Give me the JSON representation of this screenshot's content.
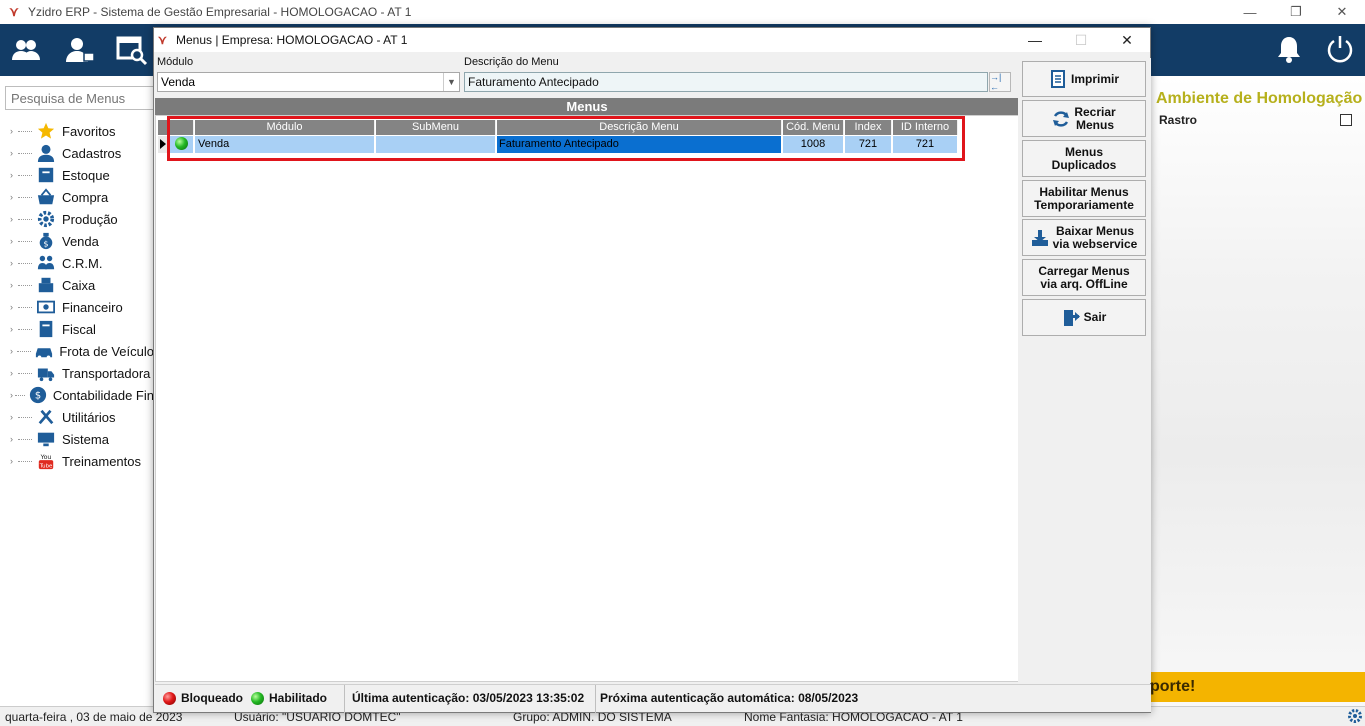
{
  "app": {
    "title": "Yzidro ERP - Sistema de Gestão Empresarial - HOMOLOGACAO - AT 1",
    "minimize": "—",
    "maximize": "❐",
    "close": "✕"
  },
  "sidebar": {
    "search_placeholder": "Pesquisa de Menus",
    "items": [
      {
        "label": "Favoritos",
        "icon": "star-icon"
      },
      {
        "label": "Cadastros",
        "icon": "person-icon"
      },
      {
        "label": "Estoque",
        "icon": "box-icon"
      },
      {
        "label": "Compra",
        "icon": "basket-icon"
      },
      {
        "label": "Produção",
        "icon": "gear-icon"
      },
      {
        "label": "Venda",
        "icon": "money-bag-icon"
      },
      {
        "label": "C.R.M.",
        "icon": "people-icon"
      },
      {
        "label": "Caixa",
        "icon": "register-icon"
      },
      {
        "label": "Financeiro",
        "icon": "cash-icon"
      },
      {
        "label": "Fiscal",
        "icon": "document-icon"
      },
      {
        "label": "Frota de Veículo",
        "icon": "car-icon"
      },
      {
        "label": "Transportadora",
        "icon": "truck-icon"
      },
      {
        "label": "Contabilidade Fin",
        "icon": "dollar-coin-icon"
      },
      {
        "label": "Utilitários",
        "icon": "tools-icon"
      },
      {
        "label": "Sistema",
        "icon": "monitor-icon"
      },
      {
        "label": "Treinamentos",
        "icon": "youtube-icon"
      }
    ]
  },
  "right_panel": {
    "environment": "Ambiente de Homologação",
    "rastro": "Rastro",
    "suporte": "porte!"
  },
  "statusbar": {
    "date": "quarta-feira ,  03  de  maio  de  2023",
    "user": "Usuário: \"USUARIO DOMTEC\"",
    "group": "Grupo: ADMIN. DO SISTEMA",
    "fantasy": "Nome Fantasia: HOMOLOGACAO - AT 1"
  },
  "dialog": {
    "title": "Menus | Empresa: HOMOLOGACAO - AT 1",
    "modulo_label": "Módulo",
    "modulo_value": "Venda",
    "desc_label": "Descrição do Menu",
    "desc_value": "Faturamento Antecipado",
    "desc_btn": "→|←",
    "menus_header": "Menus",
    "columns": [
      "Módulo",
      "SubMenu",
      "Descrição Menu",
      "Cód. Menu",
      "Index",
      "ID Interno"
    ],
    "rows": [
      {
        "modulo": "Venda",
        "submenu": "",
        "descricao": "Faturamento Antecipado",
        "cod": "1008",
        "index": "721",
        "id": "721",
        "status": "green"
      }
    ],
    "buttons": {
      "imprimir": "Imprimir",
      "recriar_1": "Recriar",
      "recriar_2": "Menus",
      "duplicados_1": "Menus",
      "duplicados_2": "Duplicados",
      "habilitar_1": "Habilitar Menus",
      "habilitar_2": "Temporariamente",
      "baixar_1": "Baixar Menus",
      "baixar_2": "via webservice",
      "carregar_1": "Carregar Menus",
      "carregar_2": "via arq. OffLine",
      "sair": "Sair"
    },
    "footer": {
      "bloqueado": "Bloqueado",
      "habilitado": "Habilitado",
      "ultima": "Última autenticação: 03/05/2023 13:35:02",
      "proxima": "Próxima autenticação automática: 08/05/2023"
    }
  },
  "colors": {
    "toolbar": "#123c66",
    "env_label": "#b6b01c",
    "suporte": "#f4b400",
    "highlight": "#e0151b",
    "row_bg": "#a9d0f5",
    "row_selected": "#0a6fd0"
  }
}
